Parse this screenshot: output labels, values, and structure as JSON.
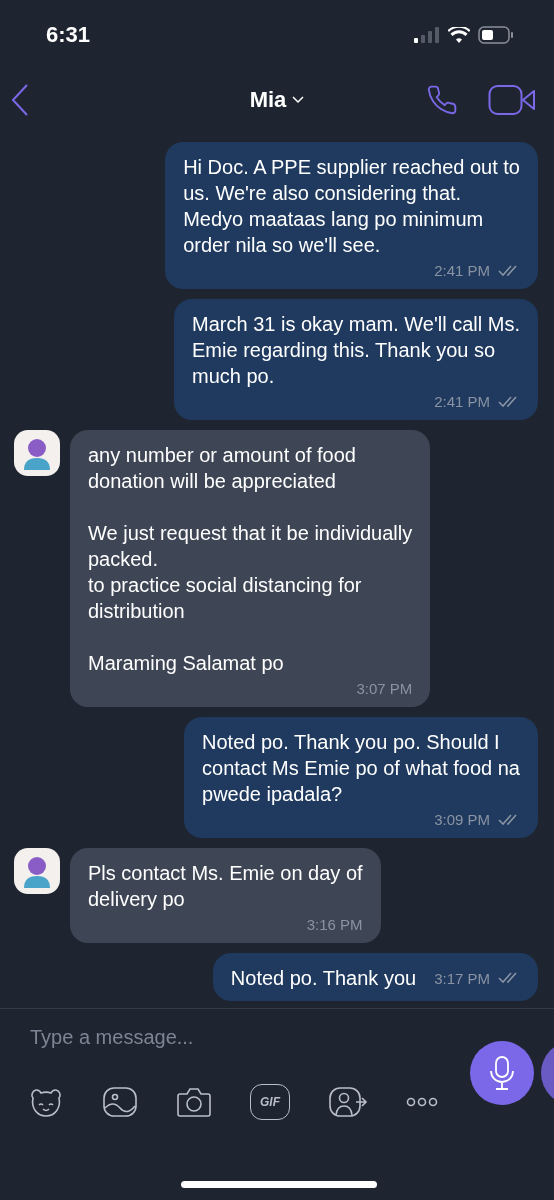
{
  "status_bar": {
    "time": "6:31"
  },
  "header": {
    "contact_name": "Mia"
  },
  "messages": [
    {
      "kind": "out",
      "text": "Hi Doc. A PPE supplier reached out to\nus. We're also considering that.\nMedyo maataas lang po minimum\norder nila so we'll see.",
      "time": "2:41 PM",
      "read": true
    },
    {
      "kind": "out",
      "text": "March 31 is okay mam. We'll call Ms.\nEmie regarding this. Thank you so\nmuch po.",
      "time": "2:41 PM",
      "read": true
    },
    {
      "kind": "in",
      "text": "any number or amount of food\ndonation will be appreciated\n\nWe just request that it be individually\npacked.\nto practice social distancing for\ndistribution\n\nMaraming Salamat po",
      "time": "3:07 PM"
    },
    {
      "kind": "out",
      "text": "Noted po. Thank you po. Should I\ncontact Ms Emie po of what food na\npwede ipadala?",
      "time": "3:09 PM",
      "read": true
    },
    {
      "kind": "in",
      "text": "Pls contact Ms. Emie on day of\ndelivery po",
      "time": "3:16 PM"
    },
    {
      "kind": "out",
      "text": "Noted po. Thank you",
      "time": "3:17 PM",
      "read": true,
      "inline_time": true
    }
  ],
  "composer": {
    "placeholder": "Type a message..."
  },
  "toolbar": [
    {
      "kind": "sticker"
    },
    {
      "kind": "gallery"
    },
    {
      "kind": "camera"
    },
    {
      "kind": "gif",
      "label": "GIF"
    },
    {
      "kind": "contact"
    },
    {
      "kind": "more"
    }
  ]
}
